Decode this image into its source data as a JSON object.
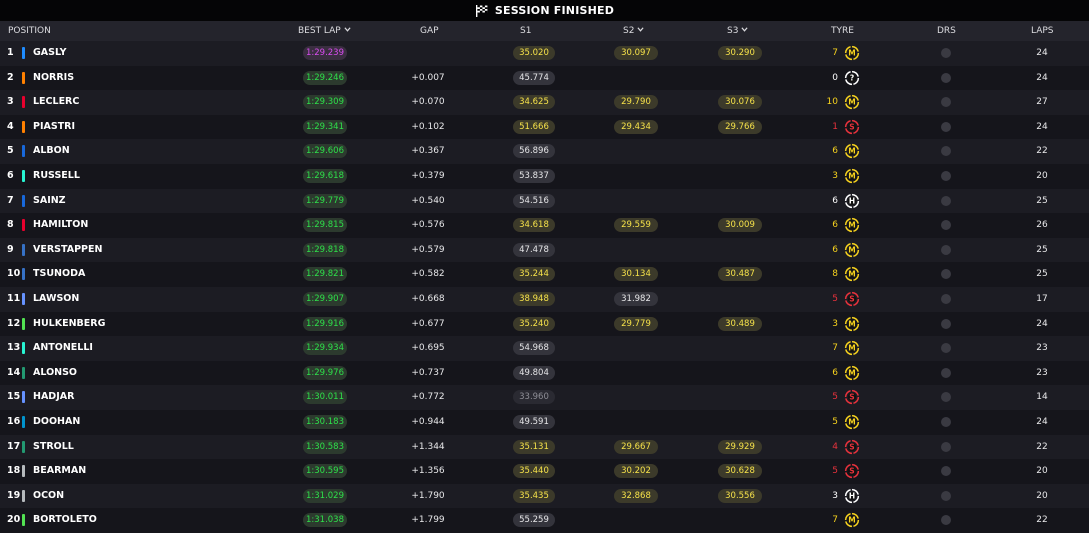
{
  "title": "SESSION FINISHED",
  "columns": {
    "position": "POSITION",
    "best_lap": "BEST LAP",
    "gap": "GAP",
    "s1": "S1",
    "s2": "S2",
    "s3": "S3",
    "tyre": "TYRE",
    "drs": "DRS",
    "laps": "LAPS"
  },
  "colors": {
    "purple": "#d94cf0",
    "green": "#2ee04a",
    "yellow": "#f6e24a",
    "soft": "#e8323c",
    "medium": "#f6d21e",
    "hard": "#ffffff",
    "unknown": "#ffffff"
  },
  "rows": [
    {
      "pos": "1",
      "name": "GASLY",
      "team": "#1e8cff",
      "best": "1:29.239",
      "best_purple": true,
      "gap": "",
      "s1": "35.020",
      "s1c": "y",
      "s2": "30.097",
      "s2c": "y",
      "s3": "30.290",
      "s3c": "y",
      "tyre_laps": "7",
      "tyre": "M",
      "laps": "24"
    },
    {
      "pos": "2",
      "name": "NORRIS",
      "team": "#ff8000",
      "best": "1:29.246",
      "gap": "+0.007",
      "s1": "45.774",
      "s1c": "w",
      "s2": "",
      "s3": "",
      "tyre_laps": "0",
      "tyre": "?",
      "laps": "24"
    },
    {
      "pos": "3",
      "name": "LECLERC",
      "team": "#e8002d",
      "best": "1:29.309",
      "gap": "+0.070",
      "s1": "34.625",
      "s1c": "y",
      "s2": "29.790",
      "s2c": "y",
      "s3": "30.076",
      "s3c": "y",
      "tyre_laps": "10",
      "tyre": "M",
      "laps": "27"
    },
    {
      "pos": "4",
      "name": "PIASTRI",
      "team": "#ff8000",
      "best": "1:29.341",
      "gap": "+0.102",
      "s1": "51.666",
      "s1c": "y",
      "s2": "29.434",
      "s2c": "y",
      "s3": "29.766",
      "s3c": "y",
      "tyre_laps": "1",
      "tyre": "S",
      "laps": "24"
    },
    {
      "pos": "5",
      "name": "ALBON",
      "team": "#1868db",
      "best": "1:29.606",
      "gap": "+0.367",
      "s1": "56.896",
      "s1c": "w",
      "s2": "",
      "s3": "",
      "tyre_laps": "6",
      "tyre": "M",
      "laps": "22"
    },
    {
      "pos": "6",
      "name": "RUSSELL",
      "team": "#27f4d2",
      "best": "1:29.618",
      "gap": "+0.379",
      "s1": "53.837",
      "s1c": "w",
      "s2": "",
      "s3": "",
      "tyre_laps": "3",
      "tyre": "M",
      "laps": "20"
    },
    {
      "pos": "7",
      "name": "SAINZ",
      "team": "#1868db",
      "best": "1:29.779",
      "gap": "+0.540",
      "s1": "54.516",
      "s1c": "w",
      "s2": "",
      "s3": "",
      "tyre_laps": "6",
      "tyre": "H",
      "laps": "25"
    },
    {
      "pos": "8",
      "name": "HAMILTON",
      "team": "#e8002d",
      "best": "1:29.815",
      "gap": "+0.576",
      "s1": "34.618",
      "s1c": "y",
      "s2": "29.559",
      "s2c": "y",
      "s3": "30.009",
      "s3c": "y",
      "tyre_laps": "6",
      "tyre": "M",
      "laps": "26"
    },
    {
      "pos": "9",
      "name": "VERSTAPPEN",
      "team": "#3671c6",
      "best": "1:29.818",
      "gap": "+0.579",
      "s1": "47.478",
      "s1c": "w",
      "s2": "",
      "s3": "",
      "tyre_laps": "6",
      "tyre": "M",
      "laps": "25"
    },
    {
      "pos": "10",
      "name": "TSUNODA",
      "team": "#3671c6",
      "best": "1:29.821",
      "gap": "+0.582",
      "s1": "35.244",
      "s1c": "y",
      "s2": "30.134",
      "s2c": "y",
      "s3": "30.487",
      "s3c": "y",
      "tyre_laps": "8",
      "tyre": "M",
      "laps": "25"
    },
    {
      "pos": "11",
      "name": "LAWSON",
      "team": "#6692ff",
      "best": "1:29.907",
      "gap": "+0.668",
      "s1": "38.948",
      "s1c": "y",
      "s2": "31.982",
      "s2c": "w",
      "s3": "",
      "tyre_laps": "5",
      "tyre": "S",
      "laps": "17"
    },
    {
      "pos": "12",
      "name": "HULKENBERG",
      "team": "#52e252",
      "best": "1:29.916",
      "gap": "+0.677",
      "s1": "35.240",
      "s1c": "y",
      "s2": "29.779",
      "s2c": "y",
      "s3": "30.489",
      "s3c": "y",
      "tyre_laps": "3",
      "tyre": "M",
      "laps": "24"
    },
    {
      "pos": "13",
      "name": "ANTONELLI",
      "team": "#27f4d2",
      "best": "1:29.934",
      "gap": "+0.695",
      "s1": "54.968",
      "s1c": "w",
      "s2": "",
      "s3": "",
      "tyre_laps": "7",
      "tyre": "M",
      "laps": "23"
    },
    {
      "pos": "14",
      "name": "ALONSO",
      "team": "#229971",
      "best": "1:29.976",
      "gap": "+0.737",
      "s1": "49.804",
      "s1c": "w",
      "s2": "",
      "s3": "",
      "tyre_laps": "6",
      "tyre": "M",
      "laps": "23"
    },
    {
      "pos": "15",
      "name": "HADJAR",
      "team": "#6692ff",
      "best": "1:30.011",
      "gap": "+0.772",
      "s1": "33.960",
      "s1c": "g",
      "s2": "",
      "s3": "",
      "tyre_laps": "5",
      "tyre": "S",
      "laps": "14"
    },
    {
      "pos": "16",
      "name": "DOOHAN",
      "team": "#0093cc",
      "best": "1:30.183",
      "gap": "+0.944",
      "s1": "49.591",
      "s1c": "w",
      "s2": "",
      "s3": "",
      "tyre_laps": "5",
      "tyre": "M",
      "laps": "24"
    },
    {
      "pos": "17",
      "name": "STROLL",
      "team": "#229971",
      "best": "1:30.583",
      "gap": "+1.344",
      "s1": "35.131",
      "s1c": "y",
      "s2": "29.667",
      "s2c": "y",
      "s3": "29.929",
      "s3c": "y",
      "tyre_laps": "4",
      "tyre": "S",
      "laps": "22"
    },
    {
      "pos": "18",
      "name": "BEARMAN",
      "team": "#b6babd",
      "best": "1:30.595",
      "gap": "+1.356",
      "s1": "35.440",
      "s1c": "y",
      "s2": "30.202",
      "s2c": "y",
      "s3": "30.628",
      "s3c": "y",
      "tyre_laps": "5",
      "tyre": "S",
      "laps": "20"
    },
    {
      "pos": "19",
      "name": "OCON",
      "team": "#b6babd",
      "best": "1:31.029",
      "gap": "+1.790",
      "s1": "35.435",
      "s1c": "y",
      "s2": "32.868",
      "s2c": "y",
      "s3": "30.556",
      "s3c": "y",
      "tyre_laps": "3",
      "tyre": "H",
      "laps": "20"
    },
    {
      "pos": "20",
      "name": "BORTOLETO",
      "team": "#52e252",
      "best": "1:31.038",
      "gap": "+1.799",
      "s1": "55.259",
      "s1c": "w",
      "s2": "",
      "s3": "",
      "tyre_laps": "7",
      "tyre": "M",
      "laps": "22"
    }
  ]
}
